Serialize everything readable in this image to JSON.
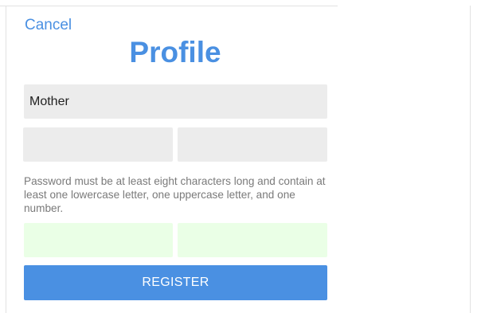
{
  "nav": {
    "cancel_label": "Cancel"
  },
  "header": {
    "title": "Profile"
  },
  "form": {
    "name_value": "Mother",
    "password_hint": "Password must be at least eight characters long and contain at least one lowercase letter, one uppercase letter, and one number.",
    "register_label": "REGISTER"
  },
  "colors": {
    "accent": "#4a90e2",
    "field_bg": "#ececec",
    "valid_field_bg": "#eaffe6",
    "hint_text": "#7a7a7a"
  }
}
